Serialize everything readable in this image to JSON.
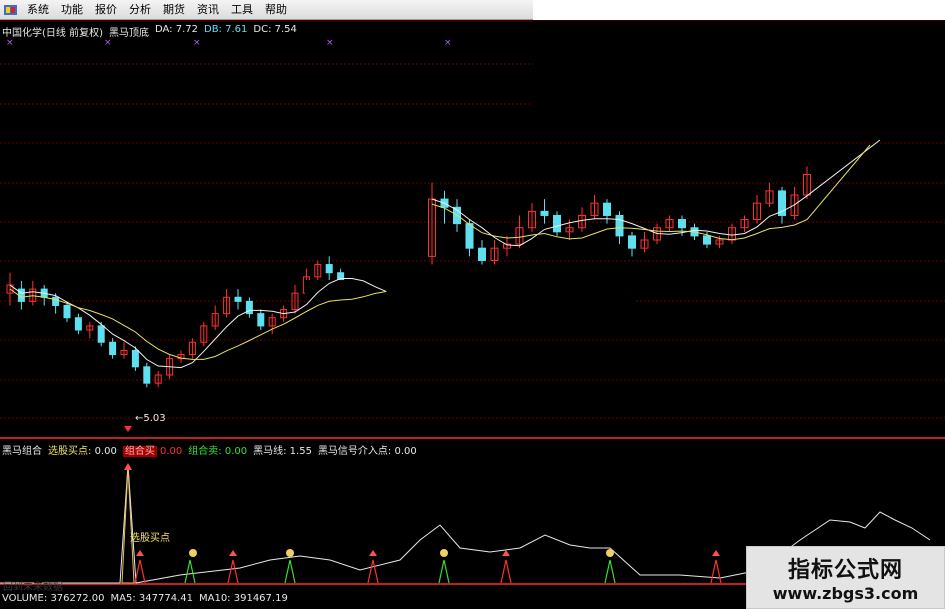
{
  "menu": {
    "items": [
      "系统",
      "功能",
      "报价",
      "分析",
      "期货",
      "资讯",
      "工具",
      "帮助"
    ]
  },
  "main_chart": {
    "header": {
      "title": "中国化学(日线 前复权)",
      "indicator": "黑马顶底",
      "da_label": "DA:",
      "da_value": "7.72",
      "db_label": "DB:",
      "db_value": "7.61",
      "dc_label": "DC:",
      "dc_value": "7.54"
    },
    "low_label": "5.03"
  },
  "indicator_panel": {
    "header": {
      "name": "黑马组合",
      "buy_label": "选股买点:",
      "buy_value": "0.00",
      "combo_buy_label": "组合买",
      "combo_buy_value": "0.00",
      "combo_sell_label": "组合卖:",
      "combo_sell_value": "0.00",
      "line_label": "黑马线:",
      "line_value": "1.55",
      "signal_label": "黑马信号介入点:",
      "signal_value": "0.00"
    },
    "annotation": "选股买点",
    "faded_text": "回到未来数据"
  },
  "volume_panel": {
    "header": {
      "volume_label": "VOLUME:",
      "volume_value": "376272.00",
      "ma5_label": "MA5:",
      "ma5_value": "347774.41",
      "ma10_label": "MA10:",
      "ma10_value": "391467.19"
    }
  },
  "watermark": {
    "title": "指标公式网",
    "url": "www.zbgs3.com"
  },
  "colors": {
    "up": "#ff3030",
    "down": "#5fe0f0",
    "separator": "#c02020",
    "grid": "#6b0000",
    "ma_short": "#f0f0f0",
    "ma_long": "#e8e060",
    "signal_line": "#e8e8e8"
  },
  "icons": [
    "system-logo-icon",
    "cross-marker-icon",
    "up-arrow-icon",
    "coin-marker-icon"
  ],
  "chart_data": {
    "type": "candlestick",
    "price_range": [
      4.6,
      9.0
    ],
    "min_price_label": 5.03,
    "candles": [
      [
        6.15,
        6.25,
        6.4,
        6.0
      ],
      [
        6.2,
        6.05,
        6.3,
        5.95
      ],
      [
        6.05,
        6.2,
        6.3,
        6.0
      ],
      [
        6.2,
        6.1,
        6.25,
        6.0
      ],
      [
        6.1,
        6.0,
        6.15,
        5.9
      ],
      [
        6.0,
        5.85,
        6.05,
        5.8
      ],
      [
        5.85,
        5.7,
        5.9,
        5.65
      ],
      [
        5.7,
        5.75,
        5.8,
        5.6
      ],
      [
        5.75,
        5.55,
        5.8,
        5.5
      ],
      [
        5.55,
        5.4,
        5.6,
        5.35
      ],
      [
        5.4,
        5.45,
        5.55,
        5.35
      ],
      [
        5.45,
        5.25,
        5.5,
        5.2
      ],
      [
        5.25,
        5.05,
        5.3,
        5.0
      ],
      [
        5.05,
        5.15,
        5.2,
        5.0
      ],
      [
        5.15,
        5.35,
        5.4,
        5.1
      ],
      [
        5.35,
        5.4,
        5.45,
        5.3
      ],
      [
        5.4,
        5.55,
        5.6,
        5.35
      ],
      [
        5.55,
        5.75,
        5.8,
        5.5
      ],
      [
        5.75,
        5.9,
        6.0,
        5.7
      ],
      [
        5.9,
        6.1,
        6.2,
        5.85
      ],
      [
        6.1,
        6.05,
        6.2,
        5.95
      ],
      [
        6.05,
        5.9,
        6.1,
        5.85
      ],
      [
        5.9,
        5.75,
        5.95,
        5.7
      ],
      [
        5.75,
        5.85,
        5.9,
        5.65
      ],
      [
        5.85,
        5.95,
        6.0,
        5.8
      ],
      [
        5.95,
        6.15,
        6.25,
        5.9
      ],
      [
        6.15,
        6.35,
        6.45,
        6.1
      ],
      [
        6.35,
        6.5,
        6.55,
        6.3
      ],
      [
        6.5,
        6.4,
        6.6,
        6.3
      ],
      [
        6.4,
        6.25,
        6.45,
        6.2
      ],
      [
        6.25,
        6.15,
        6.3,
        6.1
      ],
      [
        6.15,
        6.2,
        6.3,
        6.1
      ],
      [
        6.2,
        6.15,
        6.25,
        6.05
      ],
      [
        6.15,
        6.1,
        6.2,
        6.05
      ]
    ],
    "candles_right": [
      [
        6.6,
        7.3,
        7.5,
        6.5
      ],
      [
        7.3,
        7.2,
        7.4,
        7.0
      ],
      [
        7.2,
        7.0,
        7.3,
        6.9
      ],
      [
        7.0,
        6.7,
        7.05,
        6.6
      ],
      [
        6.7,
        6.55,
        6.8,
        6.5
      ],
      [
        6.55,
        6.7,
        6.8,
        6.5
      ],
      [
        6.7,
        6.75,
        6.85,
        6.6
      ],
      [
        6.75,
        6.95,
        7.1,
        6.7
      ],
      [
        6.95,
        7.15,
        7.25,
        6.9
      ],
      [
        7.15,
        7.1,
        7.3,
        7.0
      ],
      [
        7.1,
        6.9,
        7.15,
        6.85
      ],
      [
        6.9,
        6.95,
        7.05,
        6.8
      ],
      [
        6.95,
        7.1,
        7.2,
        6.9
      ],
      [
        7.1,
        7.25,
        7.35,
        7.05
      ],
      [
        7.25,
        7.1,
        7.3,
        7.0
      ],
      [
        7.1,
        6.85,
        7.15,
        6.75
      ],
      [
        6.85,
        6.7,
        6.9,
        6.6
      ],
      [
        6.7,
        6.8,
        6.9,
        6.65
      ],
      [
        6.8,
        6.95,
        7.0,
        6.75
      ],
      [
        6.95,
        7.05,
        7.1,
        6.9
      ],
      [
        7.05,
        6.95,
        7.1,
        6.85
      ],
      [
        6.95,
        6.85,
        7.0,
        6.8
      ],
      [
        6.85,
        6.75,
        6.9,
        6.7
      ],
      [
        6.75,
        6.8,
        6.85,
        6.7
      ],
      [
        6.8,
        6.95,
        7.0,
        6.75
      ],
      [
        6.95,
        7.05,
        7.1,
        6.9
      ],
      [
        7.05,
        7.25,
        7.35,
        7.0
      ],
      [
        7.25,
        7.4,
        7.5,
        7.2
      ],
      [
        7.4,
        7.1,
        7.45,
        7.0
      ],
      [
        7.1,
        7.35,
        7.45,
        7.05
      ],
      [
        7.35,
        7.6,
        7.7,
        7.3
      ]
    ]
  }
}
